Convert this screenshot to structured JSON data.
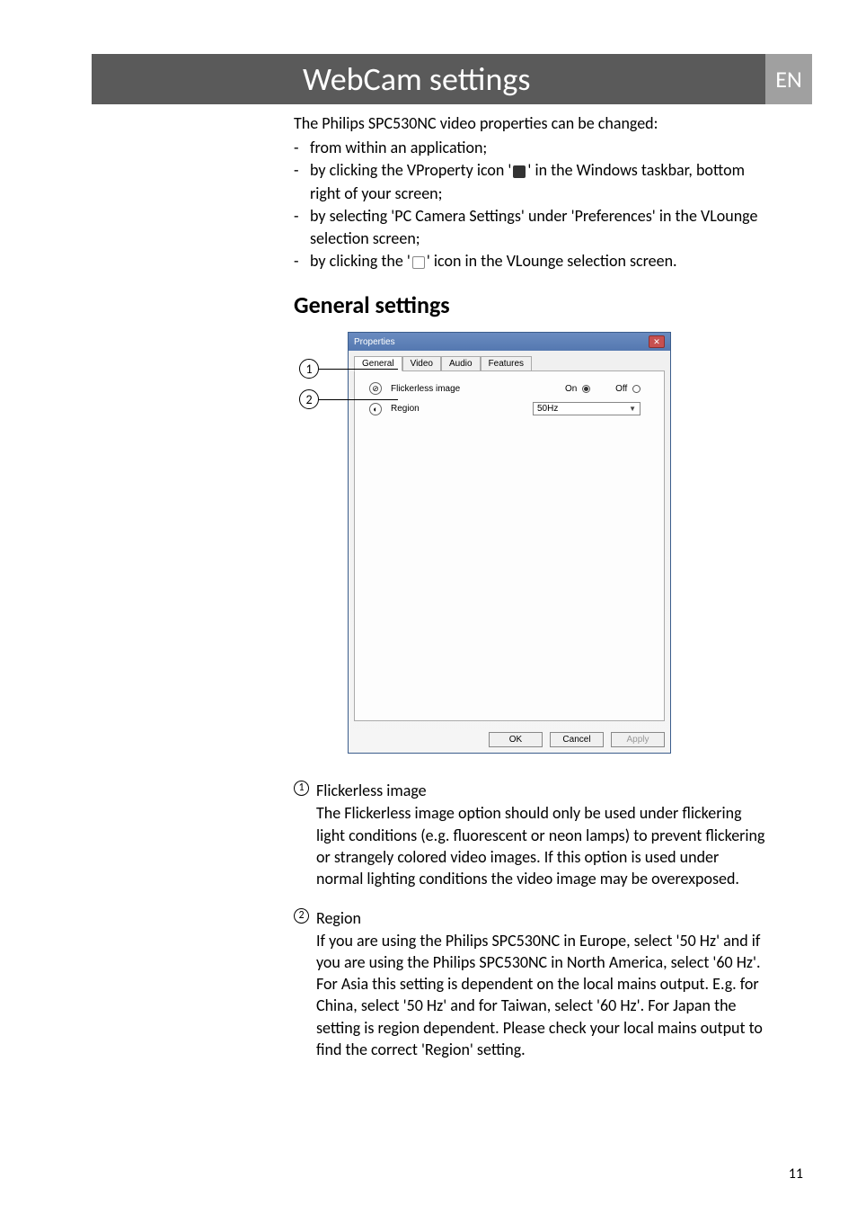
{
  "header": {
    "title": "WebCam settings",
    "lang": "EN"
  },
  "intro": "The Philips SPC530NC video properties can be changed:",
  "bullets": [
    "from within an application;",
    "by clicking the VProperty icon '__CAM__' in the Windows taskbar, bottom right of your screen;",
    "by selecting 'PC Camera Settings' under 'Preferences' in the VLounge selection screen;",
    "by clicking the '__SET__' icon in the VLounge selection screen."
  ],
  "section_heading": "General settings",
  "dialog": {
    "title": "Properties",
    "tabs": [
      "General",
      "Video",
      "Audio",
      "Features"
    ],
    "row1": {
      "label": "Flickerless image",
      "on": "On",
      "off": "Off"
    },
    "row2": {
      "label": "Region",
      "value": "50Hz"
    },
    "buttons": {
      "ok": "OK",
      "cancel": "Cancel",
      "apply": "Apply"
    }
  },
  "callouts": {
    "n1": "1",
    "n2": "2"
  },
  "descs": [
    {
      "num": "1",
      "title": "Flickerless image",
      "body": "The Flickerless image option should only be used under flickering light conditions (e.g. fluorescent or neon lamps) to prevent flickering or strangely colored video images. If this option is used under normal lighting conditions the video image may be overexposed."
    },
    {
      "num": "2",
      "title": "Region",
      "body": "If you are using the Philips SPC530NC in Europe, select '50 Hz' and if you are using the Philips SPC530NC in North America, select '60 Hz'. For Asia this setting is dependent on the local mains output. E.g. for China, select '50 Hz' and for Taiwan, select '60 Hz'. For Japan the setting is region dependent. Please check your local mains output to find the correct 'Region' setting."
    }
  ],
  "page_number": "11"
}
